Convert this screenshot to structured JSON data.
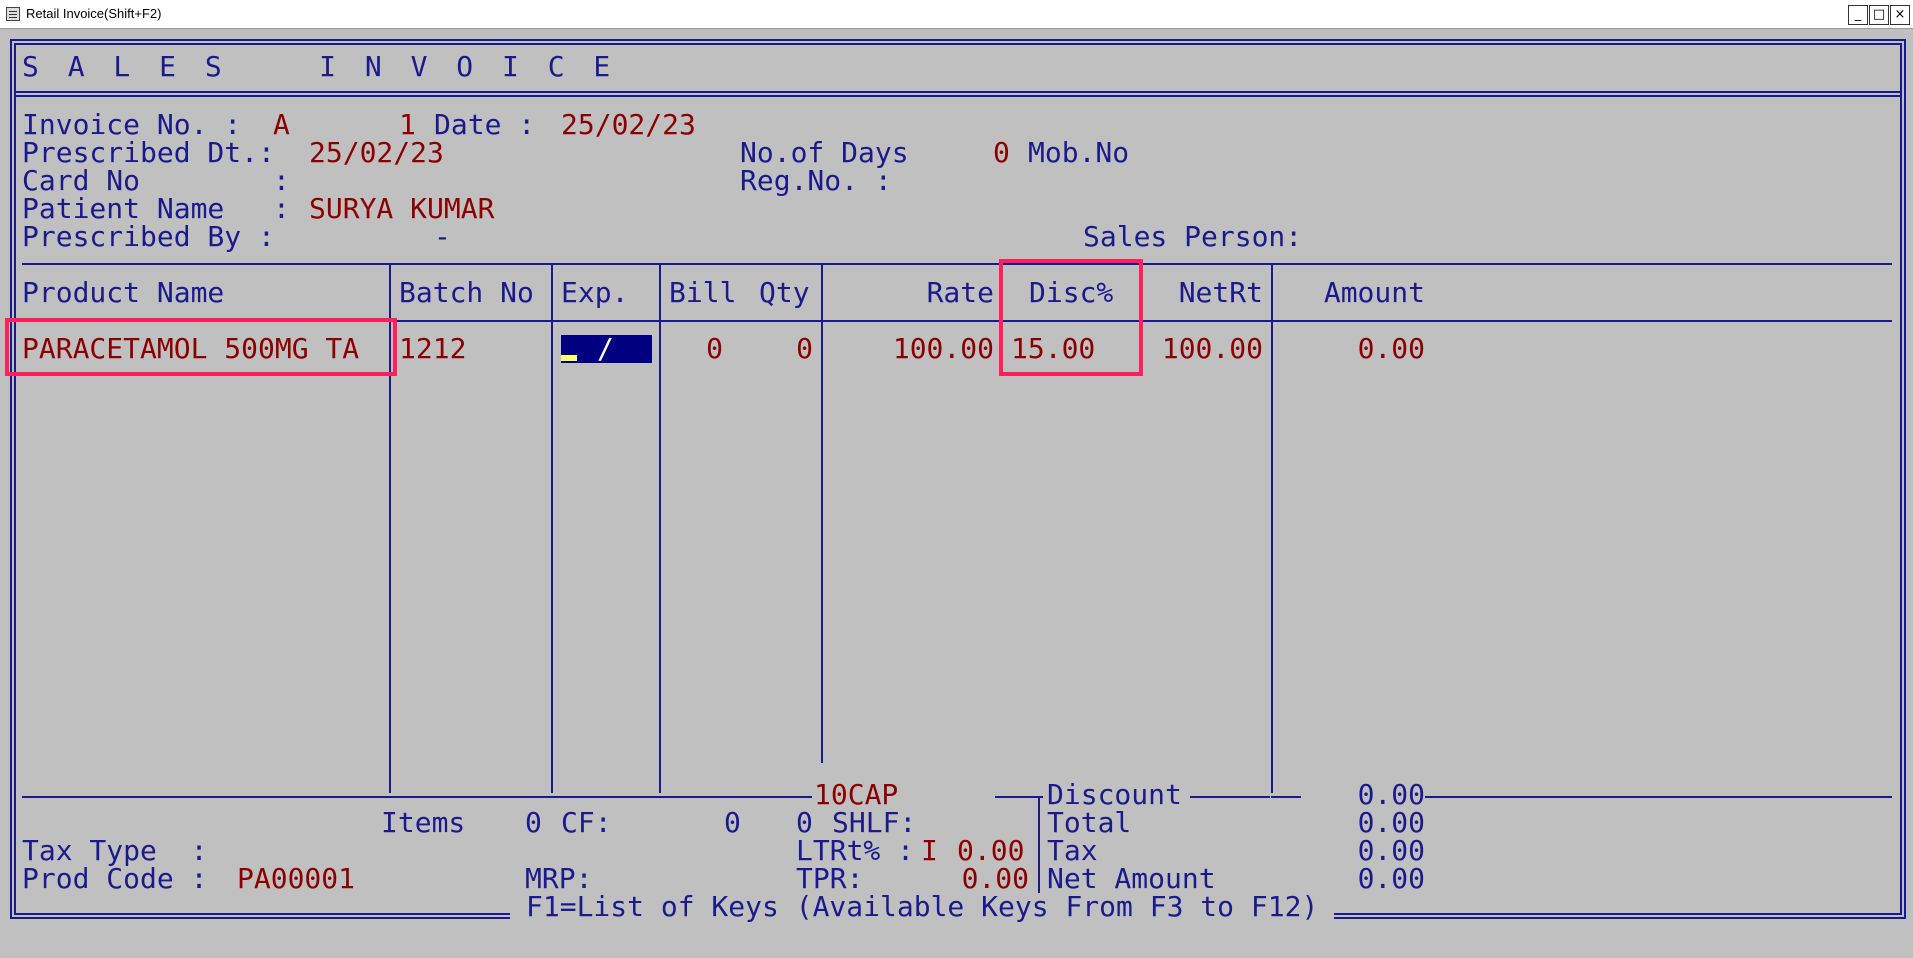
{
  "window": {
    "title": "Retail Invoice(Shift+F2)",
    "minimize_symbol": "_",
    "maximize_symbol": "□",
    "close_symbol": "×"
  },
  "header": {
    "title": "S A L E S    I N V O I C E"
  },
  "invoice": {
    "invoice_no_label": "Invoice No. :",
    "invoice_series": "A",
    "invoice_number": "1",
    "date_label": "Date :",
    "date_value": "25/02/23",
    "prescribed_dt_label": "Prescribed Dt.:",
    "prescribed_dt_value": "25/02/23",
    "no_of_days_label": "No.of Days",
    "no_of_days_value": "0",
    "mob_no_label": "Mob.No",
    "card_no_label": "Card No",
    "card_no_colon": ":",
    "reg_no_label": "Reg.No. :",
    "patient_name_label": "Patient Name",
    "patient_name_colon": ":",
    "patient_name_value": "SURYA KUMAR",
    "prescribed_by_label": "Prescribed By :",
    "prescribed_by_value": "-",
    "sales_person_label": "Sales Person:"
  },
  "table": {
    "headers": {
      "product_name": "Product Name",
      "batch_no": "Batch No",
      "exp": "Exp.",
      "bill": "Bill",
      "qty": "Qty",
      "rate": "Rate",
      "disc": "Disc%",
      "netrt": "NetRt",
      "amount": "Amount"
    },
    "rows": [
      {
        "product_name": "PARACETAMOL 500MG TA",
        "batch_no": "1212",
        "exp": "/",
        "bill": "0",
        "qty": "0",
        "rate": "100.00",
        "disc": "15.00",
        "netrt": "100.00",
        "amount": "0.00"
      }
    ]
  },
  "footer": {
    "pack": "10CAP",
    "discount_label": "Discount",
    "discount_value": "0.00",
    "items_label": "Items",
    "items_value": "0",
    "cf_label": "CF:",
    "cf_value": "0",
    "shlf_count": "0",
    "shlf_label": "SHLF:",
    "total_label": "Total",
    "total_value": "0.00",
    "tax_type_label": "Tax Type  :",
    "ltrt_label": "LTRt% :",
    "ltrt_flag": "I",
    "ltrt_value": "0.00",
    "tax_label": "Tax",
    "tax_value": "0.00",
    "prod_code_label": "Prod Code :",
    "prod_code_value": "PA00001",
    "mrp_label": "MRP:",
    "tpr_label": "TPR:",
    "tpr_value": "0.00",
    "net_amount_label": "Net Amount",
    "net_amount_value": "0.00",
    "keys_hint": "F1=List of Keys (Available Keys From F3 to F12)"
  },
  "colors": {
    "background": "#c0c0c0",
    "label_text": "#1a1a8c",
    "value_text": "#8b0000",
    "highlight_box": "#ff1f5a",
    "input_field": "#000080"
  }
}
